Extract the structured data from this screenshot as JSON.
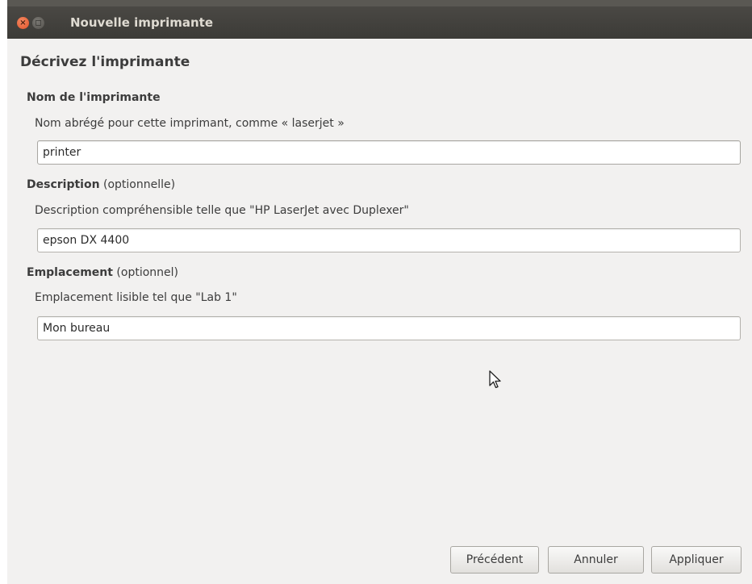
{
  "window": {
    "title": "Nouvelle imprimante",
    "close_glyph": "×",
    "max_glyph": "◻"
  },
  "page": {
    "heading": "Décrivez l'imprimante"
  },
  "name_section": {
    "label": "Nom de l'imprimante",
    "hint": "Nom abrégé pour cette imprimant, comme « laserjet »",
    "value": "printer"
  },
  "description_section": {
    "label": "Description",
    "optional": "(optionnelle)",
    "hint": "Description compréhensible telle que \"HP LaserJet avec Duplexer\"",
    "value": "epson DX 4400"
  },
  "location_section": {
    "label": "Emplacement",
    "optional": "(optionnel)",
    "hint": "Emplacement lisible tel que \"Lab 1\"",
    "value": "Mon bureau"
  },
  "buttons": {
    "previous": "Précédent",
    "cancel": "Annuler",
    "apply": "Appliquer"
  },
  "colors": {
    "titlebar": "#3c3b37",
    "close_button": "#e05228",
    "window_bg": "#f2f1f0"
  },
  "icons": {
    "close": "close-icon",
    "maximize": "maximize-icon",
    "cursor": "mouse-pointer-icon"
  }
}
